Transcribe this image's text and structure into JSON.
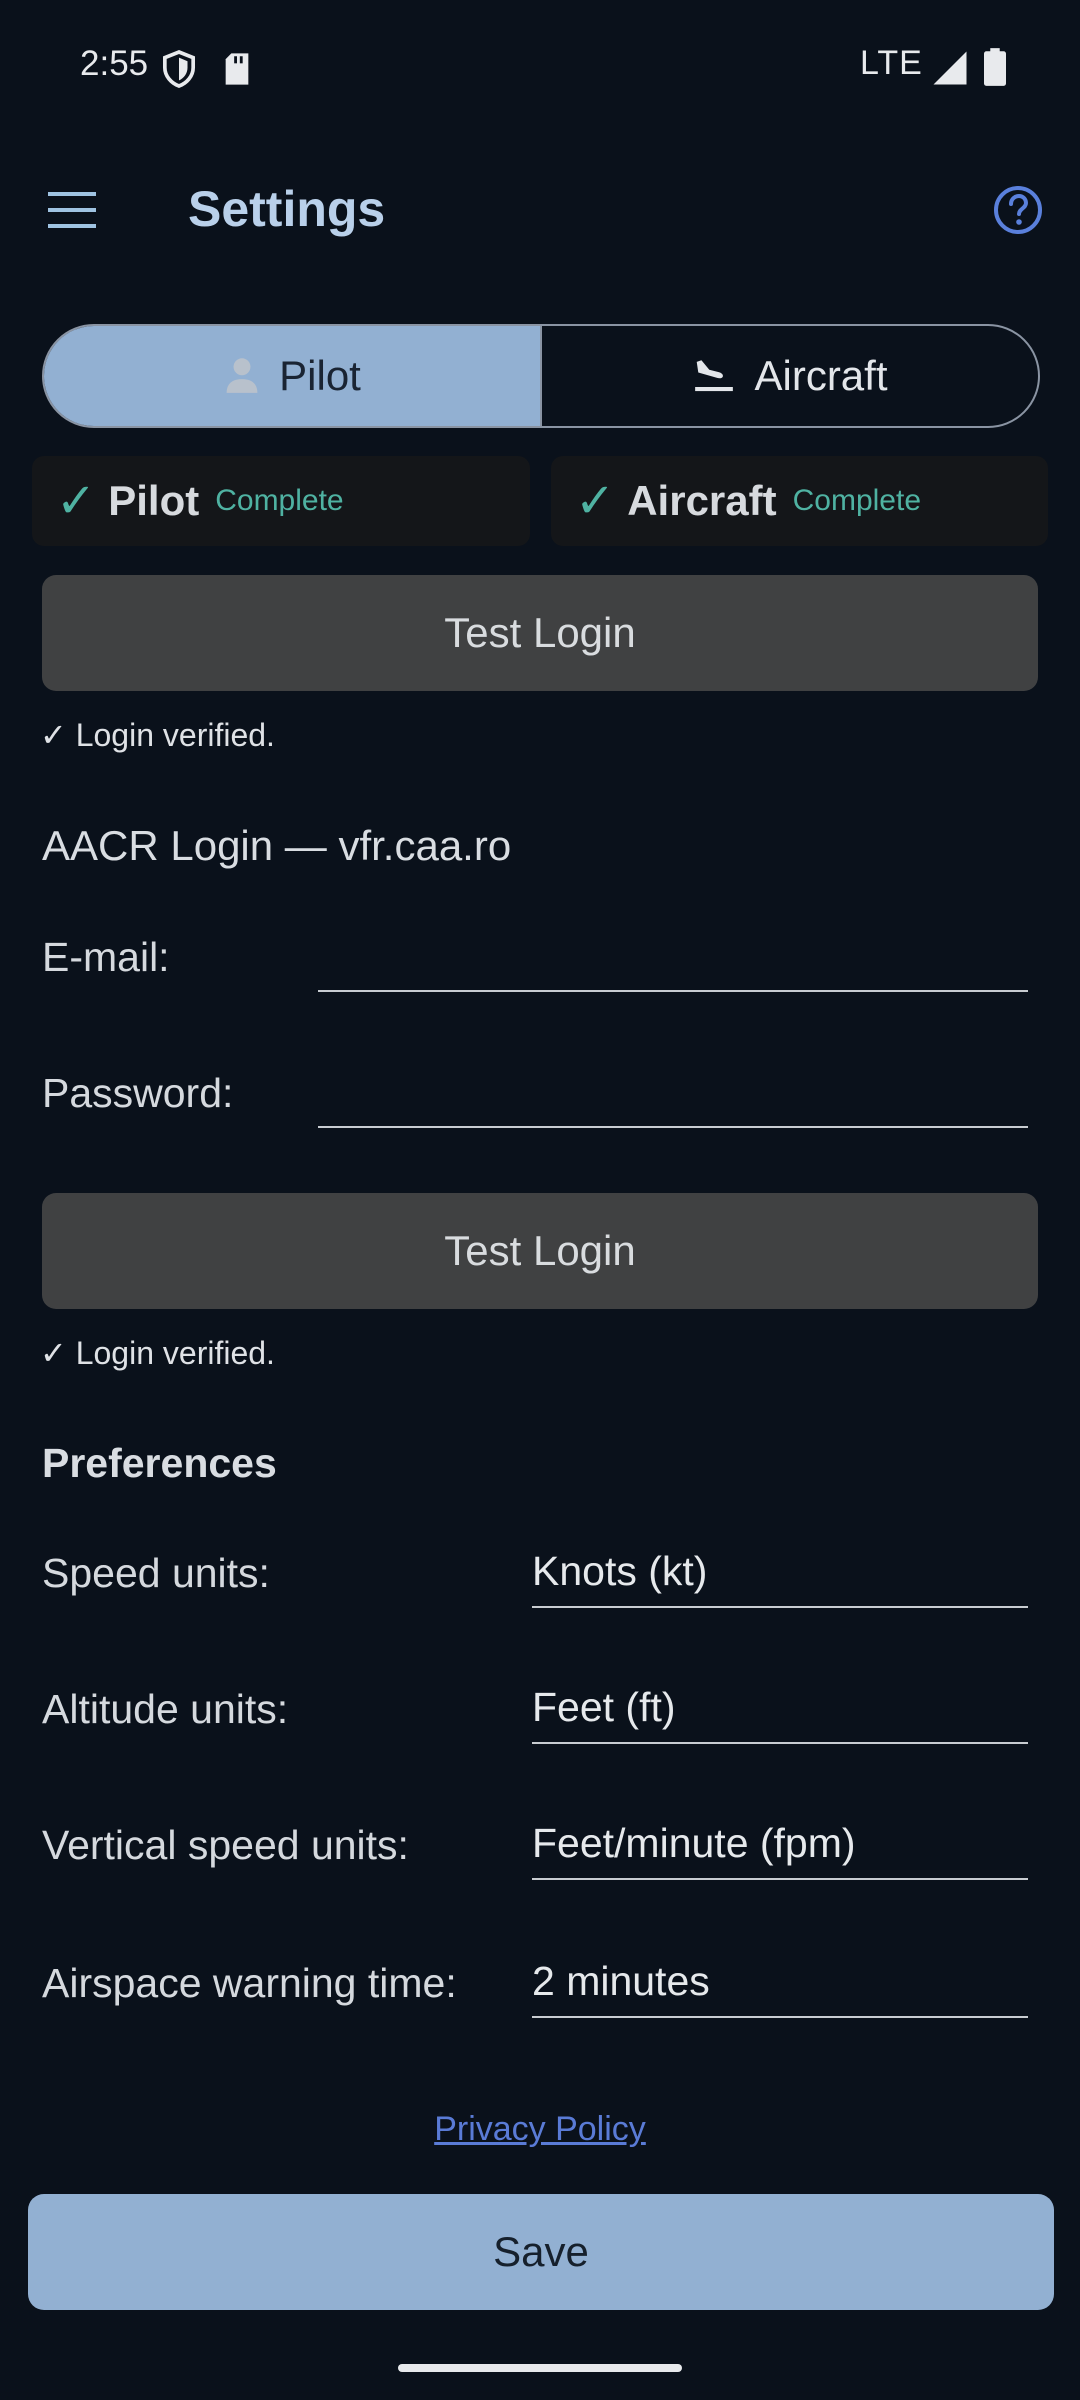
{
  "status_bar": {
    "time": "2:55",
    "network": "LTE",
    "icons": [
      "shield-icon",
      "sd-card-icon",
      "signal-icon",
      "battery-icon"
    ]
  },
  "app_bar": {
    "title": "Settings",
    "icons": [
      "menu-icon",
      "help-icon"
    ]
  },
  "tabs": [
    {
      "label": "Pilot",
      "icon": "person-icon",
      "selected": true
    },
    {
      "label": "Aircraft",
      "icon": "airplane-landing-icon",
      "selected": false
    }
  ],
  "status_cards": [
    {
      "check": "✓",
      "name": "Pilot",
      "state": "Complete"
    },
    {
      "check": "✓",
      "name": "Aircraft",
      "state": "Complete"
    }
  ],
  "login_top": {
    "button_label": "Test Login",
    "verified_text": "✓ Login verified."
  },
  "aacr": {
    "title": "AACR Login — vfr.caa.ro",
    "email_label": "E-mail:",
    "email_value": "",
    "password_label": "Password:",
    "password_value": "",
    "button_label": "Test Login",
    "verified_text": "✓ Login verified."
  },
  "preferences": {
    "title": "Preferences",
    "items": [
      {
        "label": "Speed units:",
        "value": "Knots (kt)"
      },
      {
        "label": "Altitude units:",
        "value": "Feet (ft)"
      },
      {
        "label": "Vertical speed units:",
        "value": "Feet/minute (fpm)"
      },
      {
        "label": "Airspace warning time:",
        "value": "2 minutes"
      }
    ]
  },
  "privacy_link": "Privacy Policy",
  "save_label": "Save",
  "colors": {
    "background": "#0a111b",
    "accent": "#92b0d2",
    "complete": "#4fb2a2",
    "link": "#5a7bd6",
    "button_gray": "#404142"
  }
}
